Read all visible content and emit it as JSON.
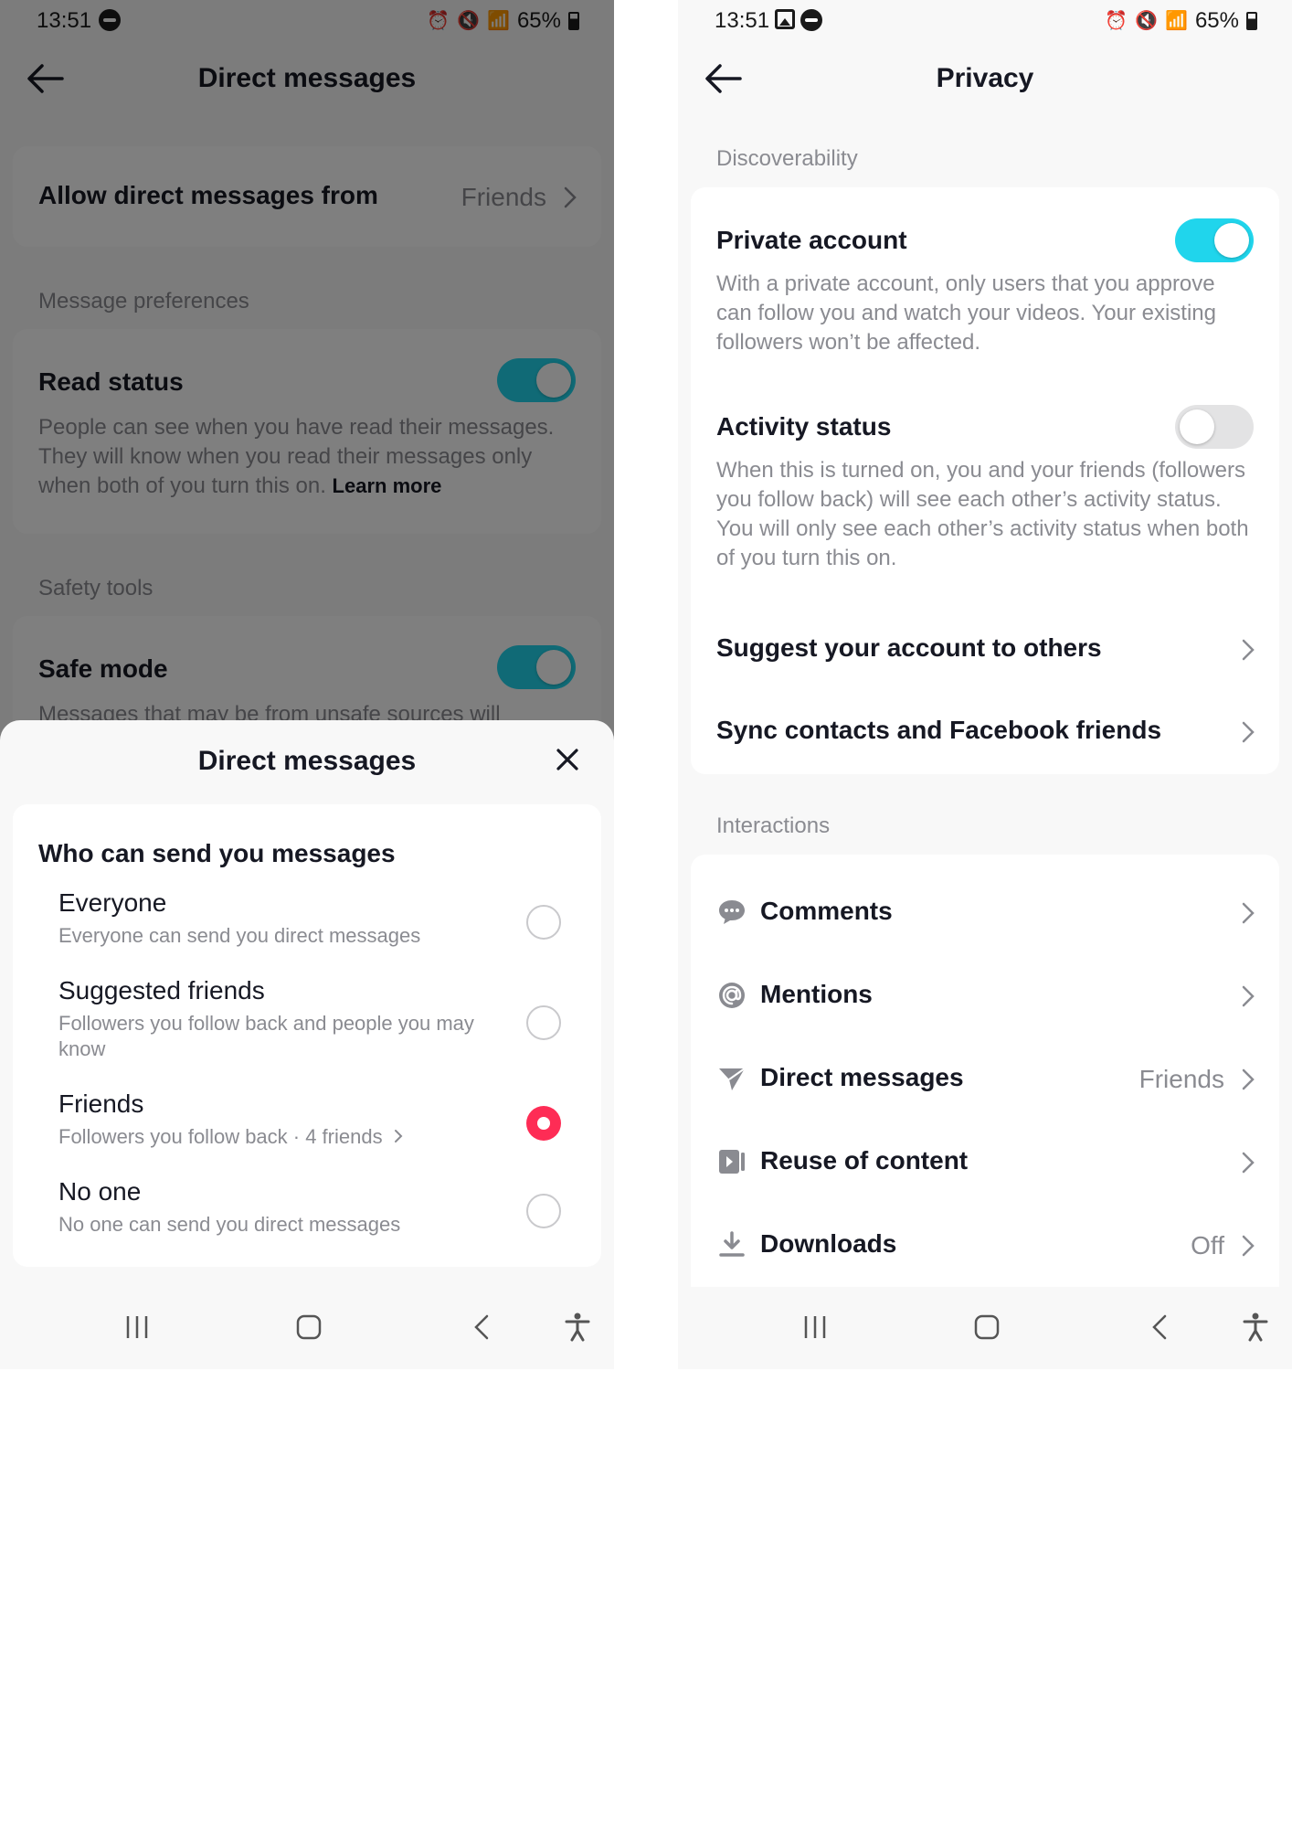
{
  "status_bar": {
    "time": "13:51",
    "battery": "65%"
  },
  "left": {
    "header": {
      "title": "Direct messages"
    },
    "allow_row": {
      "label": "Allow direct messages from",
      "value": "Friends"
    },
    "message_preferences": {
      "section_label": "Message preferences",
      "read_status": {
        "title": "Read status",
        "on": true,
        "description": "People can see when you have read their messages. They will know when you read their messages only when both of you turn this on.",
        "learn_more": "Learn more"
      }
    },
    "safety_tools": {
      "section_label": "Safety tools",
      "safe_mode": {
        "title": "Safe mode",
        "on": true,
        "description": "Messages that may be from unsafe sources will"
      }
    },
    "sheet": {
      "title": "Direct messages",
      "heading": "Who can send you messages",
      "options": [
        {
          "label": "Everyone",
          "sub": "Everyone can send you direct messages",
          "selected": false
        },
        {
          "label": "Suggested friends",
          "sub": "Followers you follow back and people you may know",
          "selected": false
        },
        {
          "label": "Friends",
          "sub": "Followers you follow back · 4 friends",
          "selected": true
        },
        {
          "label": "No one",
          "sub": "No one can send you direct messages",
          "selected": false
        }
      ]
    }
  },
  "right": {
    "header": {
      "title": "Privacy"
    },
    "discoverability": {
      "section_label": "Discoverability",
      "private_account": {
        "title": "Private account",
        "on": true,
        "description": "With a private account, only users that you approve can follow you and watch your videos. Your existing followers won’t be affected."
      },
      "activity_status": {
        "title": "Activity status",
        "on": false,
        "description": "When this is turned on, you and your friends (followers you follow back) will see each other’s activity status. You will only see each other’s activity status when both of you turn this on."
      },
      "suggest": "Suggest your account to others",
      "sync": "Sync contacts and Facebook friends"
    },
    "interactions": {
      "section_label": "Interactions",
      "items": [
        {
          "label": "Comments",
          "icon": "comment-bubble-icon",
          "value": ""
        },
        {
          "label": "Mentions",
          "icon": "at-sign-icon",
          "value": ""
        },
        {
          "label": "Direct messages",
          "icon": "send-icon",
          "value": "Friends"
        },
        {
          "label": "Reuse of content",
          "icon": "reuse-content-icon",
          "value": ""
        },
        {
          "label": "Downloads",
          "icon": "download-icon",
          "value": "Off"
        }
      ]
    }
  },
  "colors": {
    "accent_toggle": "#20d5ec",
    "accent_radio": "#fe2c55",
    "muted_text": "#8a8b91"
  }
}
